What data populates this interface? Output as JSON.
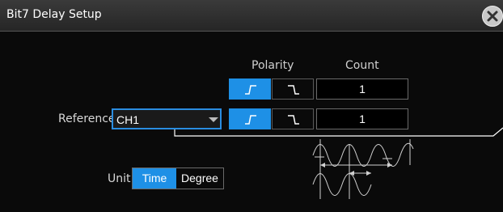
{
  "dialog": {
    "title": "Bit7 Delay Setup",
    "close_icon": "close-icon"
  },
  "headers": {
    "polarity": "Polarity",
    "count": "Count"
  },
  "row1": {
    "polarity_selected": "rising",
    "count": "1"
  },
  "reference": {
    "label": "Reference",
    "value": "CH1",
    "polarity_selected": "rising",
    "count": "1"
  },
  "unit": {
    "label": "Unit",
    "options": [
      "Time",
      "Degree"
    ],
    "selected": "Time"
  },
  "colors": {
    "accent": "#1e90e6",
    "background": "#0a0a0a",
    "titlebar": "#2e2e2e"
  },
  "icons": [
    "rising-edge-icon",
    "falling-edge-icon",
    "chevron-down-icon",
    "close-icon",
    "delay-diagram-icon"
  ]
}
